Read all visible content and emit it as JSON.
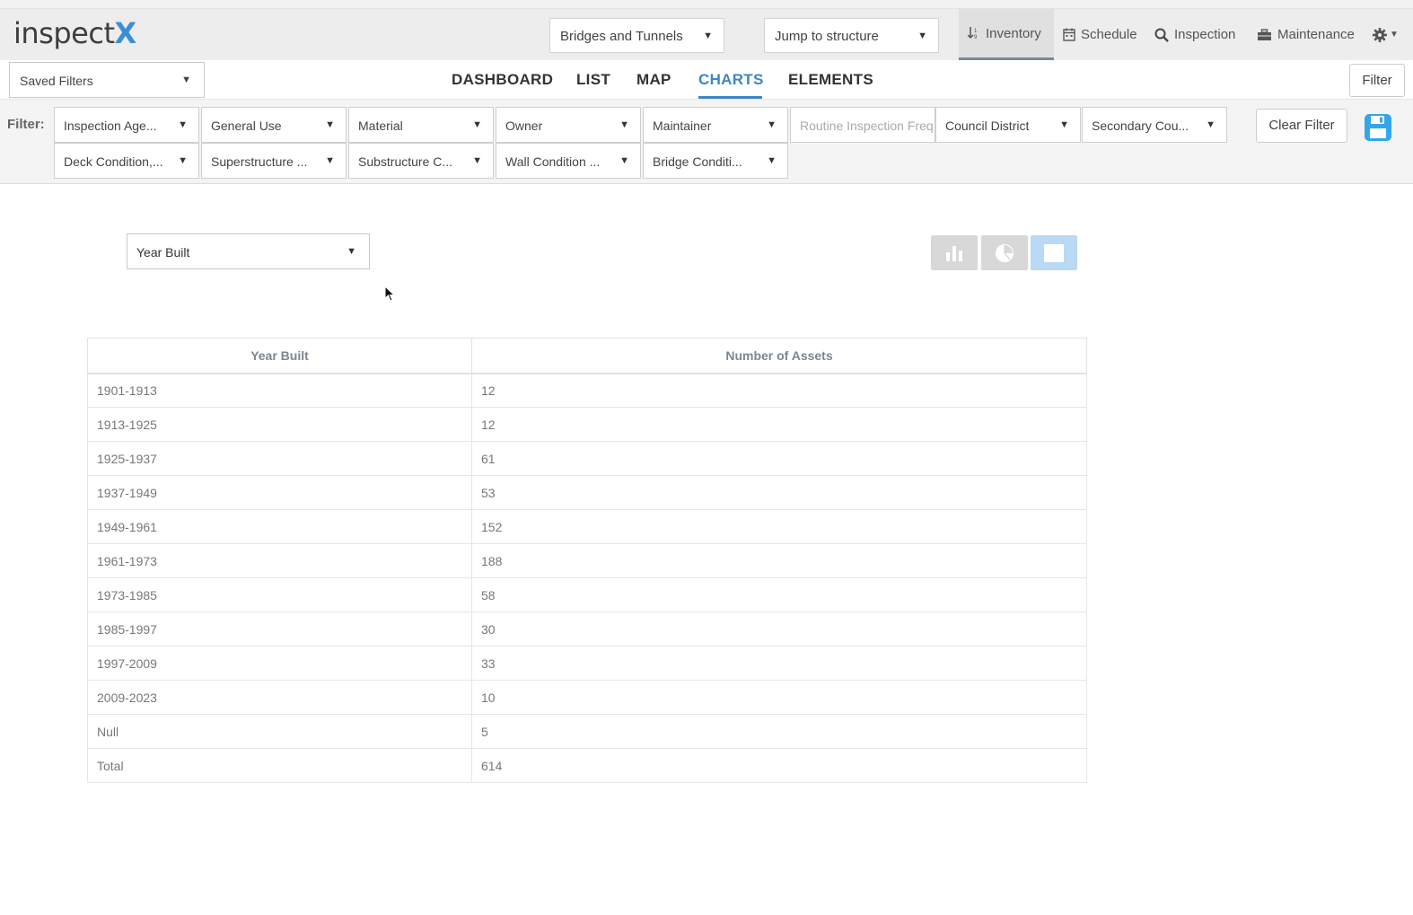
{
  "header": {
    "logo_text": "inspect",
    "logo_x": "X",
    "asset_type": "Bridges and Tunnels",
    "jump_placeholder": "Jump to structure",
    "nav": {
      "inventory": "Inventory",
      "schedule": "Schedule",
      "inspection": "Inspection",
      "maintenance": "Maintenance"
    }
  },
  "subbar": {
    "saved_filters": "Saved Filters",
    "tabs": [
      "DASHBOARD",
      "LIST",
      "MAP",
      "CHARTS",
      "ELEMENTS"
    ],
    "active_tab": "CHARTS",
    "filter_button": "Filter"
  },
  "filters": {
    "label": "Filter:",
    "row1": [
      "Inspection Age...",
      "General Use",
      "Material",
      "Owner",
      "Maintainer",
      "Routine Inspection Freq",
      "Council District",
      "Secondary Cou..."
    ],
    "row2": [
      "Deck Condition,...",
      "Superstructure ...",
      "Substructure C...",
      "Wall Condition ...",
      "Bridge Conditi..."
    ],
    "clear_button": "Clear Filter"
  },
  "chart_view": {
    "selected_field": "Year Built",
    "view_icons": [
      "bar-chart-icon",
      "pie-chart-icon",
      "table-icon"
    ],
    "active_view": "table"
  },
  "chart_data": {
    "type": "table",
    "columns": [
      "Year Built",
      "Number of Assets"
    ],
    "rows": [
      [
        "1901-1913",
        "12"
      ],
      [
        "1913-1925",
        "12"
      ],
      [
        "1925-1937",
        "61"
      ],
      [
        "1937-1949",
        "53"
      ],
      [
        "1949-1961",
        "152"
      ],
      [
        "1961-1973",
        "188"
      ],
      [
        "1973-1985",
        "58"
      ],
      [
        "1985-1997",
        "30"
      ],
      [
        "1997-2009",
        "33"
      ],
      [
        "2009-2023",
        "10"
      ],
      [
        "Null",
        "5"
      ],
      [
        "Total",
        "614"
      ]
    ]
  },
  "colors": {
    "accent": "#3d86c6",
    "logo_x": "#3a8fd4",
    "save_icon": "#35a6e8"
  }
}
